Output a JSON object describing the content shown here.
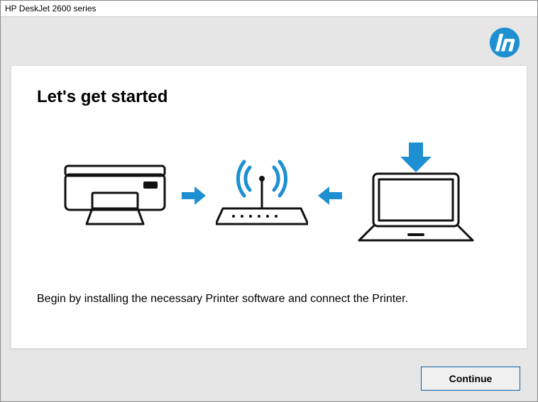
{
  "window": {
    "title": "HP DeskJet 2600 series"
  },
  "header": {
    "logo_name": "hp-logo"
  },
  "main": {
    "heading": "Let's get started",
    "body_text": "Begin by installing the necessary Printer software and connect the Printer."
  },
  "illustration": {
    "printer": "printer-icon",
    "arrow_right": "arrow-right-icon",
    "router": "wifi-router-icon",
    "arrow_left": "arrow-left-icon",
    "laptop": "laptop-icon",
    "arrow_down": "arrow-down-icon"
  },
  "footer": {
    "continue_label": "Continue"
  },
  "colors": {
    "accent": "#1e90d2",
    "stroke": "#111111"
  }
}
